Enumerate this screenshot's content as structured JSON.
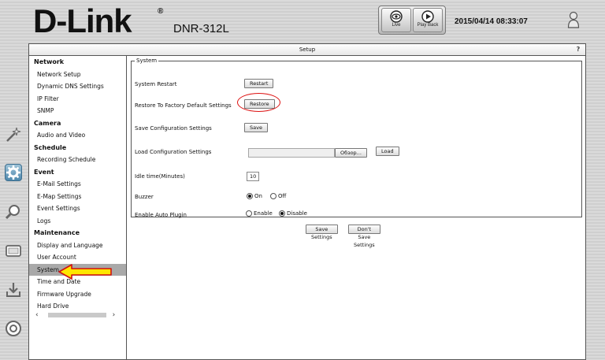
{
  "header": {
    "logo": "D-Link",
    "logo_mark": "®",
    "model": "DNR-312L",
    "live_label": "Live",
    "playback_label": "Play Back",
    "datetime": "2015/04/14 08:33:07"
  },
  "panel": {
    "title": "Setup",
    "help": "?"
  },
  "sidebar": {
    "groups": [
      {
        "title": "Network",
        "items": [
          "Network Setup",
          "Dynamic DNS Settings",
          "IP Filter",
          "SNMP"
        ]
      },
      {
        "title": "Camera",
        "items": [
          "Audio and Video"
        ]
      },
      {
        "title": "Schedule",
        "items": [
          "Recording Schedule"
        ]
      },
      {
        "title": "Event",
        "items": [
          "E-Mail Settings",
          "E-Map Settings",
          "Event Settings",
          "Logs"
        ]
      },
      {
        "title": "Maintenance",
        "items": [
          "Display and Language",
          "User Account",
          "System",
          "Time and Date",
          "Firmware Upgrade",
          "Hard Drive"
        ]
      }
    ],
    "selected": "System",
    "scroll_left": "‹",
    "scroll_right": "›"
  },
  "system": {
    "legend": "System",
    "restart_label": "System Restart",
    "restart_button": "Restart",
    "restore_label": "Restore To Factory Default Settings",
    "restore_button": "Restore",
    "save_config_label": "Save Configuration Settings",
    "save_button": "Save",
    "load_config_label": "Load Configuration Settings",
    "browse_button": "Обзор...",
    "load_button": "Load",
    "idle_label": "Idle time(Minutes)",
    "idle_value": "10",
    "buzzer_label": "Buzzer",
    "buzzer_on": "On",
    "buzzer_off": "Off",
    "buzzer_selected": "On",
    "plugin_label": "Enable Auto Plugin",
    "plugin_enable": "Enable",
    "plugin_disable": "Disable",
    "plugin_selected": "Disable"
  },
  "actions": {
    "save_settings": "Save Settings",
    "dont_save_settings": "Don't Save Settings"
  },
  "colors": {
    "highlight": "#d11111",
    "arrow_fill": "#ffe600",
    "arrow_stroke": "#d11111",
    "selected_item": "#a9a9a9"
  },
  "icons": [
    "live-eye-icon",
    "playback-icon",
    "user-icon",
    "wizard-icon",
    "setup-gear-icon",
    "search-icon",
    "monitor-icon",
    "download-icon",
    "help-icon"
  ]
}
